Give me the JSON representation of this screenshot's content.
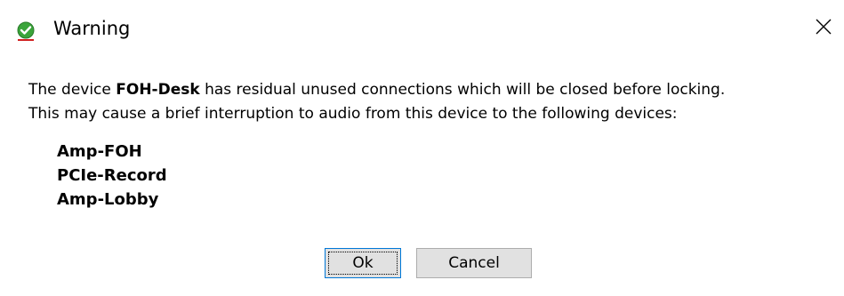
{
  "window": {
    "title": "Warning",
    "icon": "checkmark-shield-icon",
    "close_glyph": "✕"
  },
  "message": {
    "line1_prefix": "The device ",
    "device": "FOH-Desk",
    "line1_suffix": " has residual unused connections which will be closed before locking.",
    "line2": "This may cause a brief interruption to audio from this device to the following devices:"
  },
  "devices": [
    "Amp-FOH",
    "PCIe-Record",
    "Amp-Lobby"
  ],
  "buttons": {
    "ok_label": "Ok",
    "cancel_label": "Cancel"
  },
  "colors": {
    "icon_green": "#3aa43a",
    "icon_red_underline": "#d02020",
    "focus_blue": "#0078d7",
    "button_face": "#e1e1e1"
  }
}
